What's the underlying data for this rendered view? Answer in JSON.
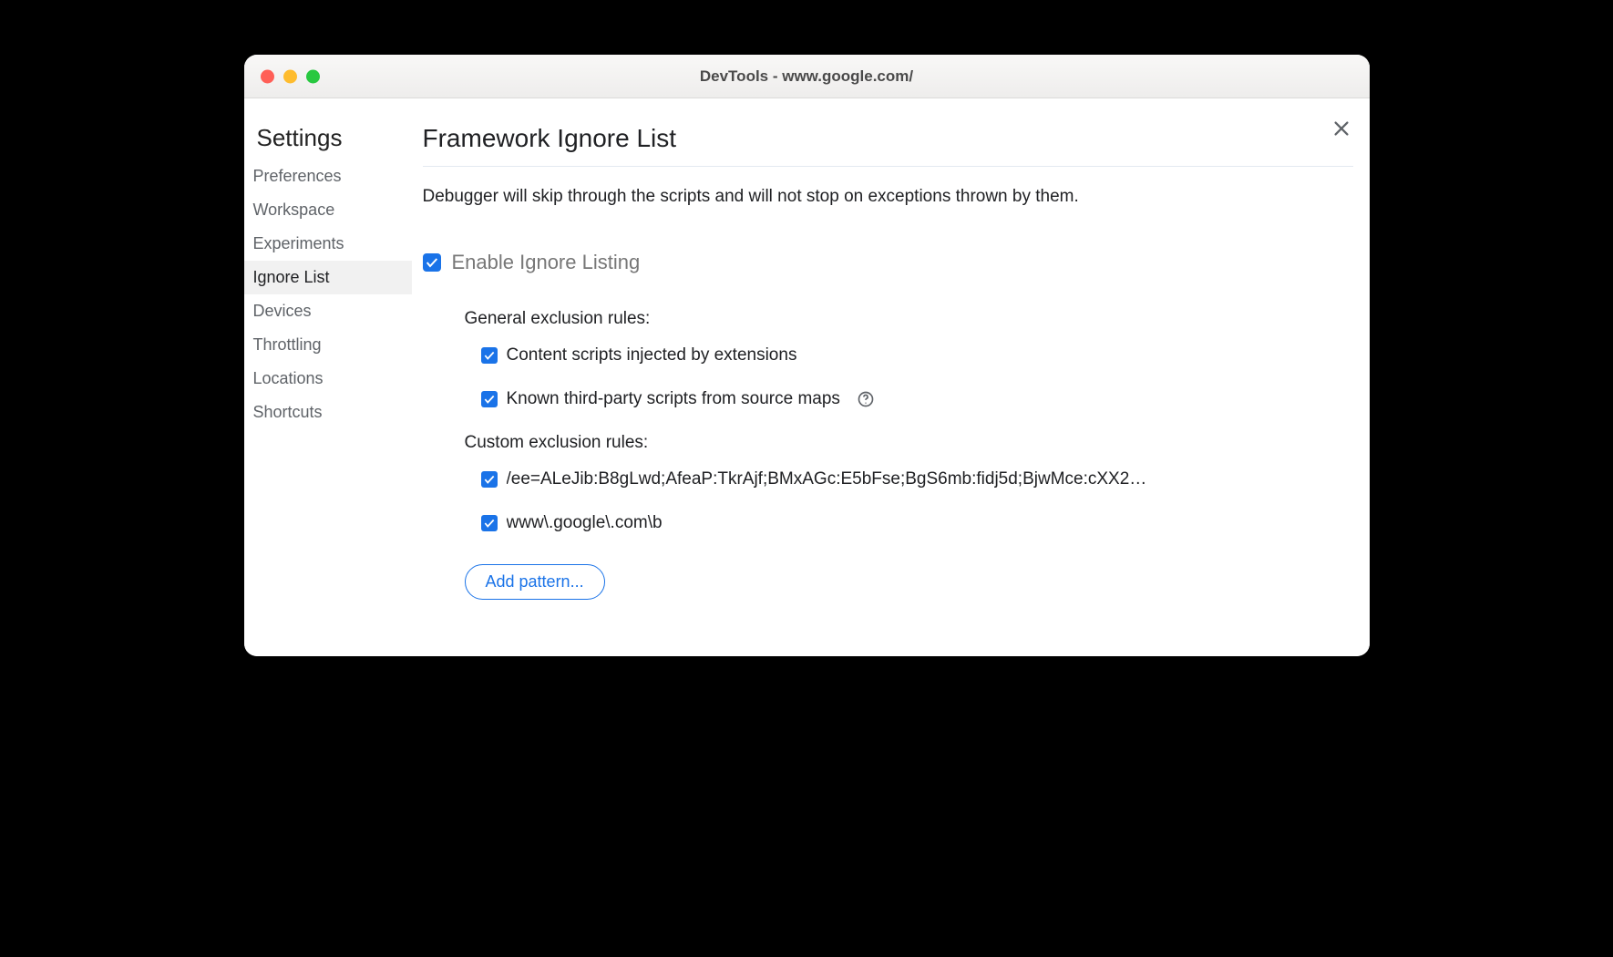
{
  "window": {
    "title": "DevTools - www.google.com/"
  },
  "sidebar": {
    "title": "Settings",
    "items": [
      {
        "label": "Preferences",
        "active": false
      },
      {
        "label": "Workspace",
        "active": false
      },
      {
        "label": "Experiments",
        "active": false
      },
      {
        "label": "Ignore List",
        "active": true
      },
      {
        "label": "Devices",
        "active": false
      },
      {
        "label": "Throttling",
        "active": false
      },
      {
        "label": "Locations",
        "active": false
      },
      {
        "label": "Shortcuts",
        "active": false
      }
    ]
  },
  "main": {
    "title": "Framework Ignore List",
    "description": "Debugger will skip through the scripts and will not stop on exceptions thrown by them.",
    "enable_label": "Enable Ignore Listing",
    "enable_checked": true,
    "general_rules_heading": "General exclusion rules:",
    "general_rules": [
      {
        "label": "Content scripts injected by extensions",
        "checked": true,
        "help": false
      },
      {
        "label": "Known third-party scripts from source maps",
        "checked": true,
        "help": true
      }
    ],
    "custom_rules_heading": "Custom exclusion rules:",
    "custom_rules": [
      {
        "label": "/ee=ALeJib:B8gLwd;AfeaP:TkrAjf;BMxAGc:E5bFse;BgS6mb:fidj5d;BjwMce:cXX2…",
        "checked": true
      },
      {
        "label": "www\\.google\\.com\\b",
        "checked": true
      }
    ],
    "add_pattern_label": "Add pattern..."
  }
}
